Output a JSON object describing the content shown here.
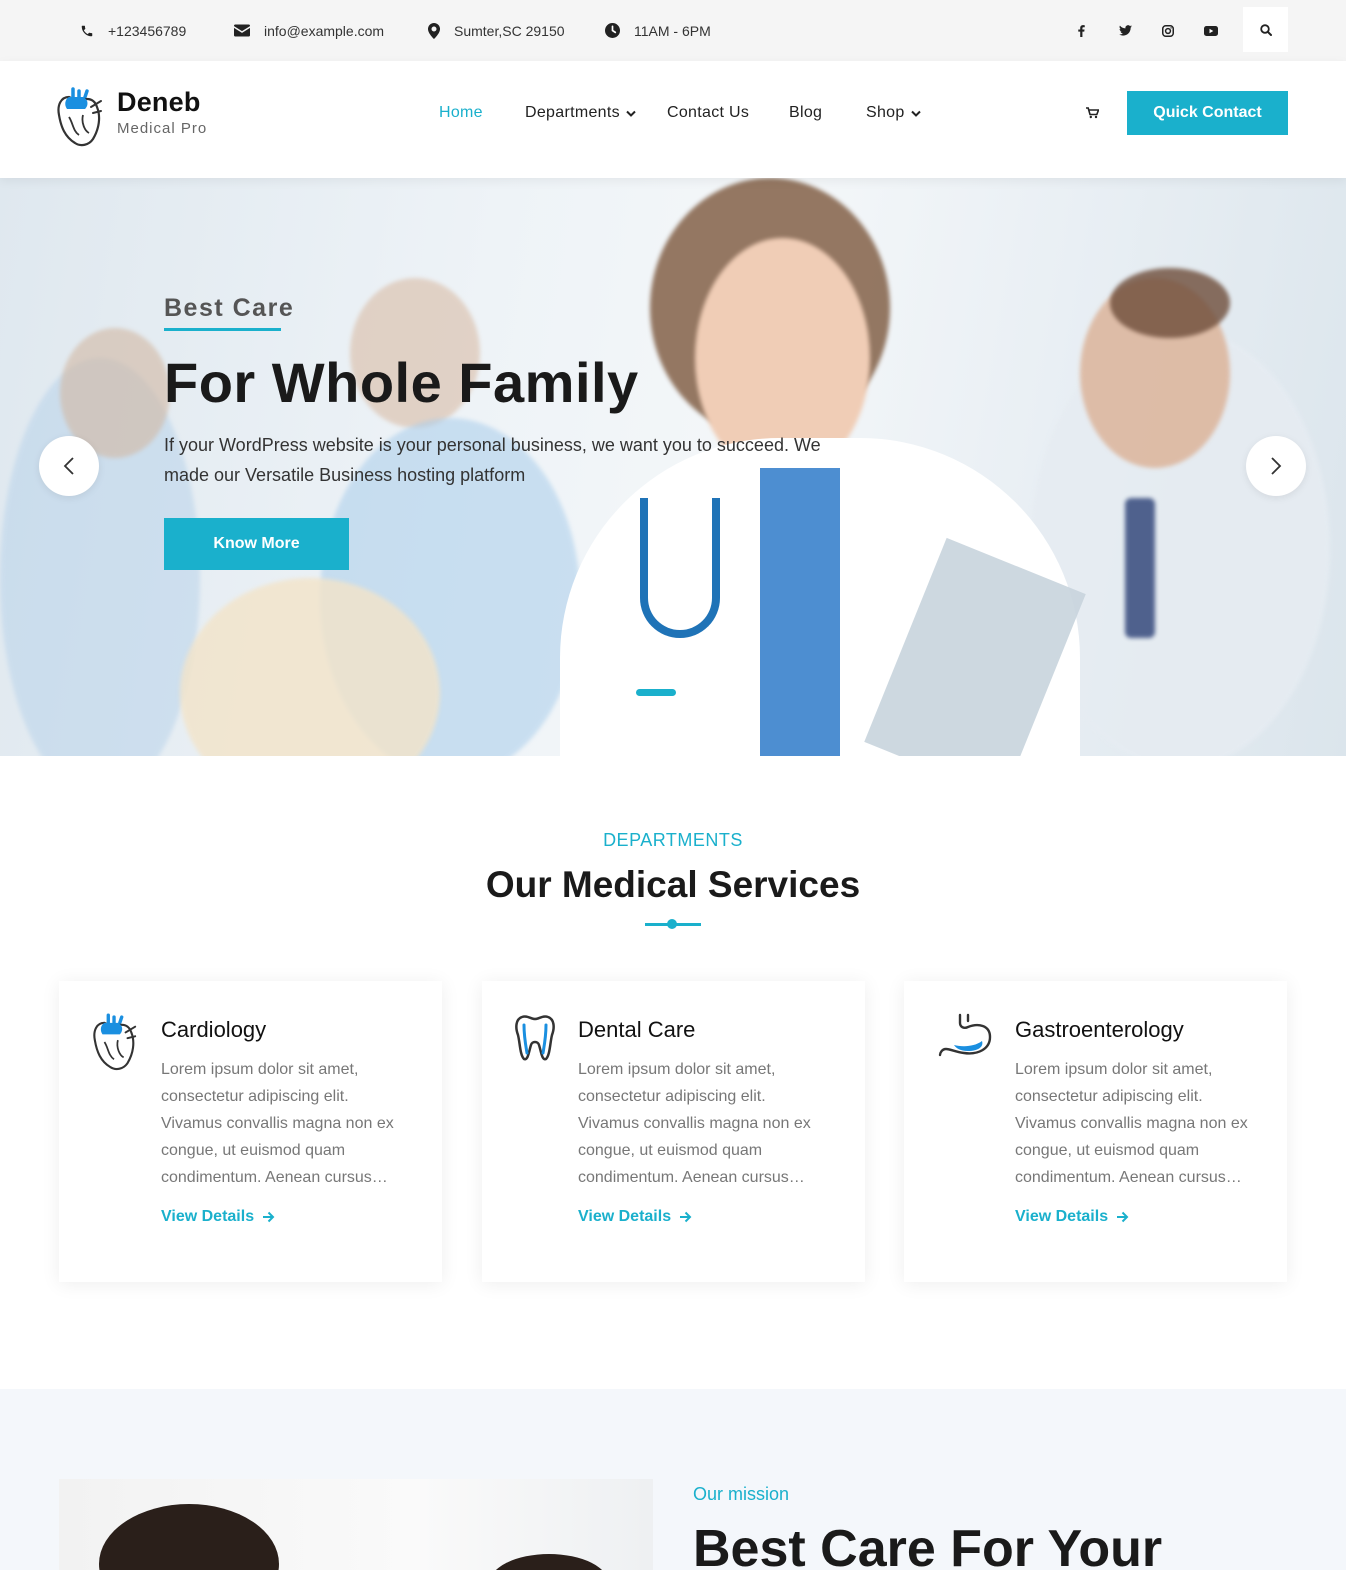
{
  "topbar": {
    "phone": "+123456789",
    "email": "info@example.com",
    "address": "Sumter,SC 29150",
    "hours": "11AM - 6PM",
    "social_icons": [
      "facebook-icon",
      "twitter-icon",
      "instagram-icon",
      "youtube-icon"
    ],
    "search_icon": "search-icon"
  },
  "header": {
    "brand_name": "Deneb",
    "brand_tagline": "Medical Pro",
    "nav": {
      "home": "Home",
      "departments": "Departments",
      "contact": "Contact Us",
      "blog": "Blog",
      "shop": "Shop"
    },
    "cta": "Quick Contact"
  },
  "hero": {
    "subtitle": "Best Care",
    "title": "For Whole Family",
    "text": "If your WordPress website is your personal business, we want you to succeed. We made our Versatile Business hosting platform",
    "button": "Know More",
    "slides_total": 2,
    "active_slide": 1
  },
  "departments": {
    "label": "DEPARTMENTS",
    "title": "Our Medical Services",
    "cards": [
      {
        "icon": "heart-icon",
        "title": "Cardiology",
        "text": "Lorem ipsum dolor sit amet, consectetur adipiscing elit. Vivamus convallis magna non ex congue, ut euismod quam condimentum. Aenean cursus…",
        "link": "View Details"
      },
      {
        "icon": "tooth-icon",
        "title": "Dental Care",
        "text": "Lorem ipsum dolor sit amet, consectetur adipiscing elit. Vivamus convallis magna non ex congue, ut euismod quam condimentum. Aenean cursus…",
        "link": "View Details"
      },
      {
        "icon": "stomach-icon",
        "title": "Gastroenterology",
        "text": "Lorem ipsum dolor sit amet, consectetur adipiscing elit. Vivamus convallis magna non ex congue, ut euismod quam condimentum. Aenean cursus…",
        "link": "View Details"
      }
    ]
  },
  "mission": {
    "label": "Our mission",
    "title": "Best Care For Your"
  },
  "colors": {
    "accent": "#1ab0cc",
    "heading": "#1a1a1a",
    "muted": "#777777",
    "topbar_bg": "#f5f5f5",
    "mission_bg": "#f4f7fb"
  }
}
